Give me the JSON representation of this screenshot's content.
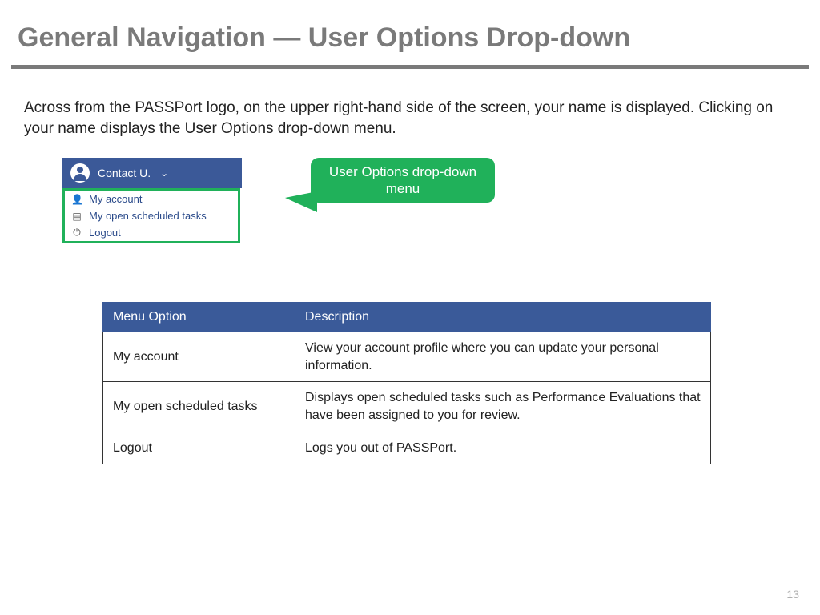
{
  "title": "General Navigation — User Options Drop-down",
  "intro": "Across from the PASSPort logo, on the upper right-hand side of the screen, your name is displayed. Clicking on your name displays the User Options drop-down menu.",
  "ui": {
    "contact_name": "Contact U.",
    "menu": [
      {
        "icon": "person",
        "label": "My account"
      },
      {
        "icon": "doc",
        "label": "My open scheduled tasks"
      },
      {
        "icon": "power",
        "label": "Logout"
      }
    ]
  },
  "callout": "User Options drop-down menu",
  "table": {
    "headers": [
      "Menu Option",
      "Description"
    ],
    "rows": [
      [
        "My account",
        "View your account profile where you can update your personal information."
      ],
      [
        "My open scheduled tasks",
        "Displays open scheduled tasks such as Performance Evaluations that have been assigned to you for review."
      ],
      [
        "Logout",
        "Logs you out of PASSPort."
      ]
    ]
  },
  "page_number": "13"
}
